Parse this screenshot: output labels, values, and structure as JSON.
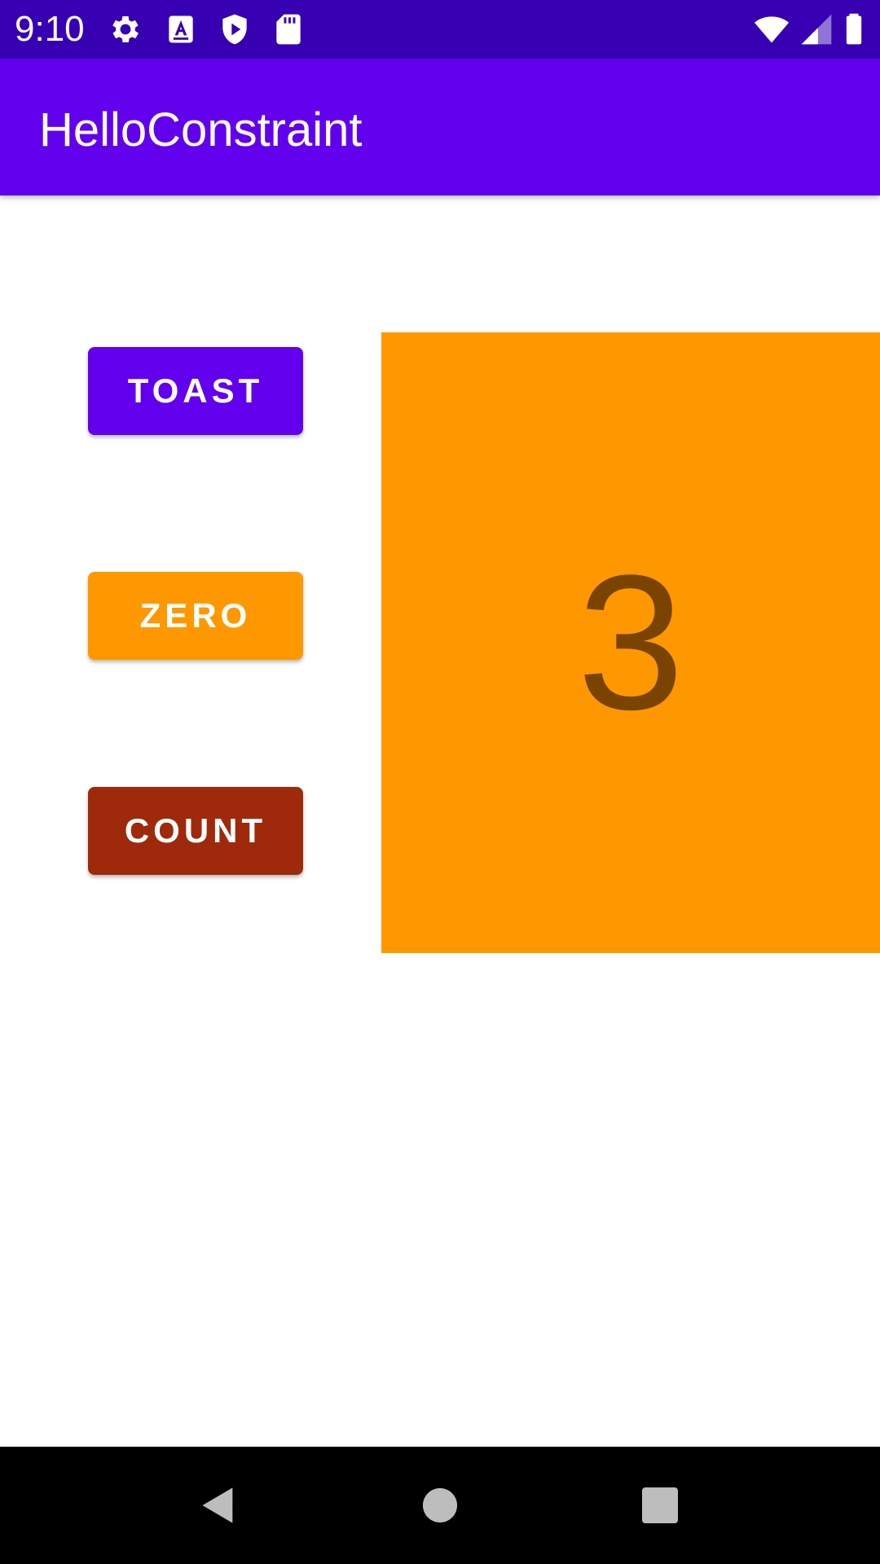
{
  "status_bar": {
    "time": "9:10",
    "icons_left": [
      "gear-icon",
      "text-format-icon",
      "shield-play-icon",
      "sd-card-icon"
    ],
    "icons_right": [
      "wifi-icon",
      "cell-signal-icon",
      "battery-icon"
    ],
    "background": "#3700b3"
  },
  "app_bar": {
    "title": "HelloConstraint",
    "background": "#6200ee"
  },
  "buttons": {
    "toast": {
      "label": "TOAST",
      "color": "#6200ee"
    },
    "zero": {
      "label": "ZERO",
      "color": "#ff9800"
    },
    "count": {
      "label": "COUNT",
      "color": "#9e2a0b"
    }
  },
  "counter": {
    "value": "3",
    "background": "#ff9800",
    "text_color": "#7a4400"
  },
  "nav_bar": {
    "buttons": [
      "back-icon",
      "home-icon",
      "recents-icon"
    ]
  }
}
